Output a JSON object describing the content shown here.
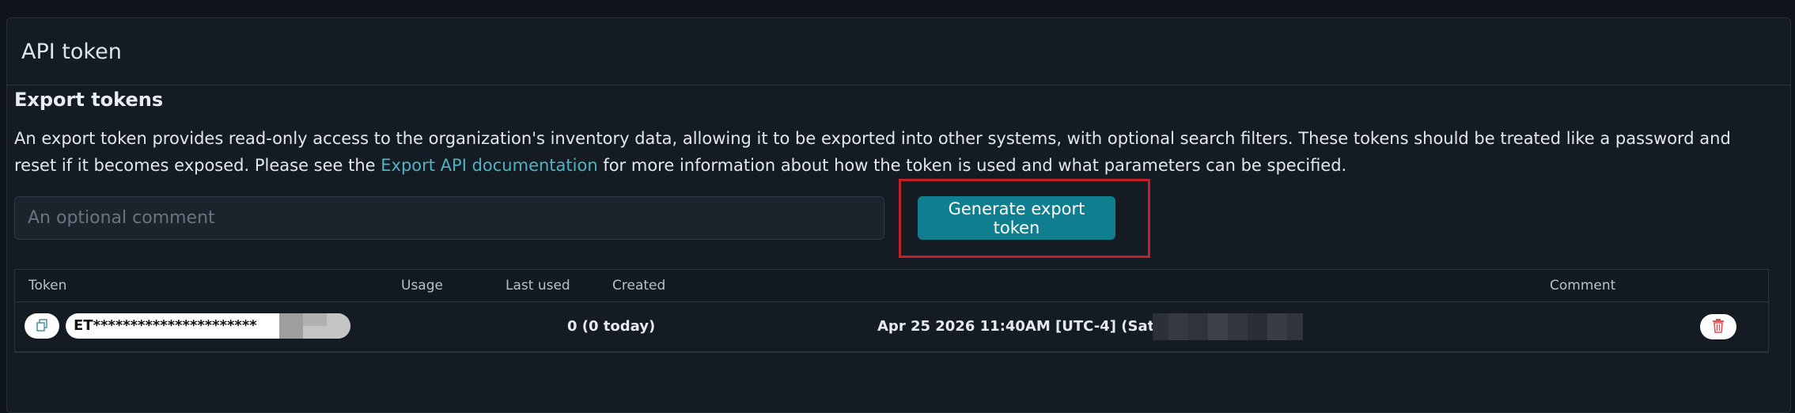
{
  "panel": {
    "title": "API token"
  },
  "export": {
    "section_title": "Export tokens",
    "description_part1": "An export token provides read-only access to the organization's inventory data, allowing it to be exported into other systems, with optional search filters. These tokens should be treated like a password and reset if it becomes exposed. Please see the ",
    "doc_link": "Export API documentation",
    "description_part2": " for more information about how the token is used and what parameters can be specified.",
    "comment_placeholder": "An optional comment",
    "generate_label": "Generate export token"
  },
  "table": {
    "headers": {
      "token": "Token",
      "usage": "Usage",
      "last_used": "Last used",
      "created": "Created",
      "comment": "Comment"
    },
    "rows": [
      {
        "token": "ET**********************",
        "usage": "0 (0 today)",
        "last_used": "",
        "created": "Apr 25 2026 11:40AM [UTC-4] (Sat) by",
        "comment": ""
      }
    ]
  },
  "colors": {
    "accent": "#0f7f8f",
    "link": "#4fb3c4",
    "highlight": "#c0202a",
    "danger": "#e05252"
  },
  "icons": {
    "copy": "copy-icon",
    "delete": "trash-icon"
  }
}
